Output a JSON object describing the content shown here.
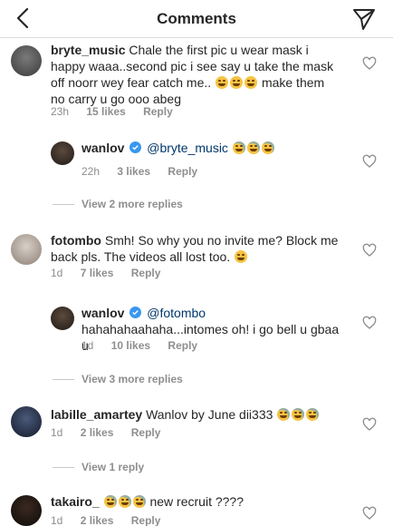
{
  "header": {
    "title": "Comments",
    "back_icon": "chevron-left-icon",
    "dm_icon": "paper-plane-icon"
  },
  "comments": [
    {
      "username": "bryte_music",
      "text": "Chale the first pic u wear mask i happy waaa..second pic i see say u take the mask off noorr wey fear catch me.. ",
      "text_tail": "make them no carry u go ooo abeg",
      "time": "23h",
      "likes": "15 likes",
      "reply": "Reply"
    },
    {
      "username": "wanlov",
      "verified": true,
      "mention": "@bryte_music",
      "text": "",
      "time": "22h",
      "likes": "3 likes",
      "reply": "Reply"
    },
    {
      "view_more": "View 2 more replies"
    },
    {
      "username": "fotombo",
      "text": "Smh! So why you no invite me? Block me back pls. The videos all lost too. ",
      "time": "1d",
      "likes": "7 likes",
      "reply": "Reply"
    },
    {
      "username": "wanlov",
      "verified": true,
      "mention": "@fotombo",
      "text": "hahahahaahaha...intomes oh! i go bell u gbaa u",
      "time": "1d",
      "likes": "10 likes",
      "reply": "Reply"
    },
    {
      "view_more": "View 3 more replies"
    },
    {
      "username": "labille_amartey",
      "text": "Wanlov by June dii333 ",
      "time": "1d",
      "likes": "2 likes",
      "reply": "Reply"
    },
    {
      "view_more": "View 1 reply"
    },
    {
      "username": "takairo_",
      "text": " new recruit ????",
      "time": "1d",
      "likes": "2 likes",
      "reply": "Reply"
    }
  ]
}
